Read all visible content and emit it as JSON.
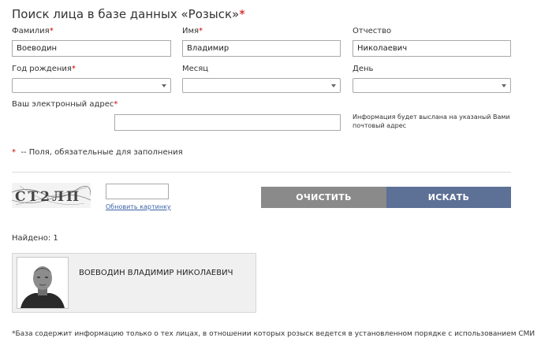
{
  "page": {
    "title": "Поиск лица в базе данных «Розыск»",
    "required_mark": "*"
  },
  "form": {
    "last_name": {
      "label": "Фамилия",
      "value": "Воеводин",
      "required": true
    },
    "first_name": {
      "label": "Имя",
      "value": "Владимир",
      "required": true
    },
    "patronymic": {
      "label": "Отчество",
      "value": "Николаевич"
    },
    "birth_year": {
      "label": "Год рождения",
      "value": "",
      "required": true
    },
    "month": {
      "label": "Месяц",
      "value": ""
    },
    "day": {
      "label": "День",
      "value": ""
    },
    "email": {
      "label": "Ваш электронный адрес",
      "value": "",
      "required": true
    },
    "email_note": "Информация будет выслана на указаный Вами почтовый адрес",
    "required_legend": "--  Поля, обязательные для заполнения"
  },
  "captcha": {
    "image_text": "СТ2ЛП",
    "input_value": "",
    "refresh_label": "Обновить картинку"
  },
  "buttons": {
    "clear_label": "ОЧИСТИТЬ",
    "search_label": "ИСКАТЬ"
  },
  "results": {
    "found_label": "Найдено: 1",
    "items": [
      {
        "name": "ВОЕВОДИН ВЛАДИМИР НИКОЛАЕВИЧ"
      }
    ]
  },
  "footnote": "*База содержит информацию только о тех лицах, в отношении которых розыск ведется в установленном порядке с использованием СМИ",
  "colors": {
    "clear_button": "#8a8a8a",
    "search_button": "#5d7095",
    "required": "#cc0000"
  }
}
